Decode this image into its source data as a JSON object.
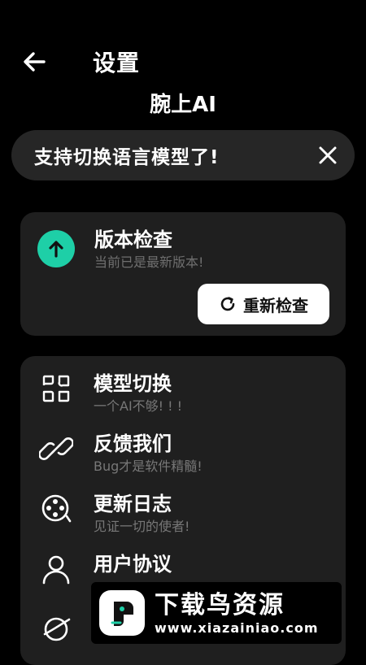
{
  "header": {
    "back_icon": "back-arrow-icon",
    "title": "设置",
    "app_name": "腕上AI"
  },
  "notice": {
    "text": "支持切换语言模型了!",
    "close_icon": "close-icon"
  },
  "version_card": {
    "icon": "arrow-up-circle-icon",
    "title": "版本检查",
    "subtitle": "当前已是最新版本!",
    "recheck_label": "重新检查",
    "recheck_icon": "refresh-icon",
    "accent_color": "#1ecfa7"
  },
  "menu": {
    "items": [
      {
        "icon": "model-switch-icon",
        "title": "模型切换",
        "subtitle": "一个AI不够! ! !"
      },
      {
        "icon": "link-icon",
        "title": "反馈我们",
        "subtitle": "Bug才是软件精髓!"
      },
      {
        "icon": "film-reel-icon",
        "title": "更新日志",
        "subtitle": "见证一切的使者!"
      },
      {
        "icon": "user-icon",
        "title": "用户协议",
        "subtitle": ""
      },
      {
        "icon": "privacy-icon",
        "title": "",
        "subtitle": ""
      }
    ]
  },
  "watermark": {
    "title": "下载鸟资源",
    "url": "www.xiazainiao.com"
  }
}
